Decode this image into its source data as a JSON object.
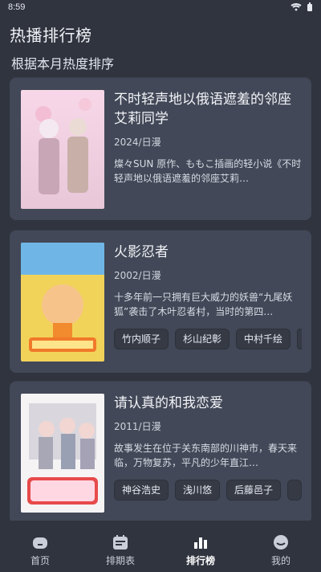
{
  "status_bar": {
    "time": "8:59"
  },
  "header": {
    "title": "热播排行榜",
    "subtitle": "根据本月热度排序"
  },
  "cards": [
    {
      "title": "不时轻声地以俄语遮羞的邻座艾莉同学",
      "meta": "2024/日漫",
      "desc": "燦々SUN 原作、ももこ插画的轻小说《不时轻声地以俄语遮羞的邻座艾莉…",
      "tags": []
    },
    {
      "title": "火影忍者",
      "meta": "2002/日漫",
      "desc": "十多年前一只拥有巨大威力的妖兽“九尾妖狐”袭击了木叶忍者村，当时的第四…",
      "tags": [
        "竹内顺子",
        "杉山纪彰",
        "中村千绘"
      ]
    },
    {
      "title": "请认真的和我恋爱",
      "meta": "2011/日漫",
      "desc": "故事发生在位于关东南部的川神市，春天来临，万物复苏，平凡的少年直江…",
      "tags": [
        "神谷浩史",
        "浅川悠",
        "后藤邑子"
      ]
    }
  ],
  "bottom_nav": {
    "tabs": [
      {
        "label": "首页",
        "icon": "home-icon",
        "active": false
      },
      {
        "label": "排期表",
        "icon": "schedule-icon",
        "active": false
      },
      {
        "label": "排行榜",
        "icon": "chart-bars-icon",
        "active": true
      },
      {
        "label": "我的",
        "icon": "profile-smile-icon",
        "active": false
      }
    ]
  },
  "colors": {
    "background": "#30343f",
    "card": "#424857",
    "chip": "#353a45",
    "text_primary": "#f1f3f7",
    "text_secondary": "#cfd4dd",
    "active_tab": "#ffffff",
    "inactive_tab": "#c9ced8"
  }
}
